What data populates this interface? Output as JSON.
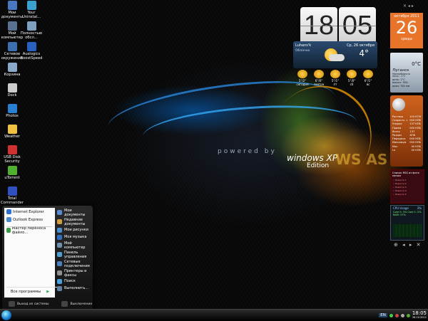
{
  "desktop_icons": [
    {
      "label": "Мои документы",
      "icon": "folder-icon",
      "color": "#4a78c0"
    },
    {
      "label": "Your Uninstal...",
      "icon": "uninstall-icon",
      "color": "#3aa0d0"
    },
    {
      "label": "Мой компьютер",
      "icon": "computer-icon",
      "color": "#5a7090"
    },
    {
      "label": "Полностью обсл...",
      "icon": "service-icon",
      "color": "#80a0c0"
    },
    {
      "label": "Сетевое окружение",
      "icon": "network-icon",
      "color": "#3b6fb0"
    },
    {
      "label": "Auslogics BoostSpeed",
      "icon": "boost-icon",
      "color": "#2a60c0"
    },
    {
      "label": "Корзина",
      "icon": "recycle-bin-icon",
      "color": "#8aa8c8"
    },
    {
      "label": "Dock",
      "icon": "dock-icon",
      "color": "#cccccc"
    },
    {
      "label": "Photos",
      "icon": "photos-icon",
      "color": "#2a80d0"
    },
    {
      "label": "Weather",
      "icon": "weather-icon",
      "color": "#f0c040"
    },
    {
      "label": "USB Disk Security",
      "icon": "usb-security-icon",
      "color": "#d03030"
    },
    {
      "label": "uTorrent",
      "icon": "utorrent-icon",
      "color": "#50b030"
    },
    {
      "label": "Total Commander",
      "icon": "total-commander-icon",
      "color": "#3050c0"
    }
  ],
  "brand": {
    "tagline": "powered by",
    "product": "windows XP",
    "edition": "Edition",
    "watermark": "WS AS"
  },
  "clock": {
    "hours": "18",
    "minutes": "05"
  },
  "weather": {
    "city": "Luhans'k",
    "condition": "Облачно",
    "date": "Ср, 26 октября",
    "temp": "4°",
    "forecast": [
      {
        "temp": "5°/2°",
        "day": "сегодня"
      },
      {
        "temp": "6°/0°",
        "day": "завтра"
      },
      {
        "temp": "5°/1°",
        "day": "пт"
      },
      {
        "temp": "5°/0°",
        "day": "сб"
      },
      {
        "temp": "6°/1°",
        "day": "вс"
      }
    ]
  },
  "calendar": {
    "month": "октября 2011",
    "day": "26",
    "weekday": "среда"
  },
  "gadget_controls": "✕ ◂ ▸",
  "weather2": {
    "temp": "0°C",
    "city": "Луганск",
    "sub": "Малооблачно",
    "rows": [
      "ночь: -1°C",
      "день: 1°C",
      "влажн: 78%",
      "давл: 762 мм"
    ]
  },
  "network": {
    "rows": [
      {
        "k": "Раствор",
        "v": "100 КГМ"
      },
      {
        "k": "Скорость ↓",
        "v": "000 КПБ"
      },
      {
        "k": "Упорка",
        "v": "137 КПБ"
      },
      {
        "k": "Прием",
        "v": "000 КПБ"
      },
      {
        "k": "Всего Раздач",
        "v": "137 КПБ"
      },
      {
        "k": "Передача",
        "v": "000 КПБ"
      },
      {
        "k": "Максимум",
        "v": "000 КПБ"
      },
      {
        "k": "Max",
        "v": "00 КПБ"
      },
      {
        "k": "Lo",
        "v": "00 КПБ"
      }
    ]
  },
  "rss": {
    "title": "Список RSS из фото мечом",
    "items": [
      "• Новости 1",
      "• Новости 2",
      "• Новости 3",
      "• Новости 4",
      "• Новости 5"
    ]
  },
  "cpu": {
    "title": "CPU Usage",
    "value": "3%",
    "cores": "Core 0: 3%  Core 1: 2%",
    "ram": "RAM: 37%"
  },
  "sidebar_controls": "⊕ ◂ ▸ ✕",
  "start_menu": {
    "pinned": [
      {
        "label": "Internet Explorer",
        "color": "#2a70d0"
      },
      {
        "label": "Outlook Express",
        "color": "#4a8ad0"
      }
    ],
    "recent": [
      {
        "label": "Мастер переноса файло...",
        "color": "#3a9a40"
      }
    ],
    "all_programs": "Все программы",
    "right_items": [
      {
        "label": "Мои документы",
        "color": "#5a8ad0"
      },
      {
        "label": "Недавние документы",
        "color": "#d0a040"
      },
      {
        "label": "Мои рисунки",
        "color": "#4a90d0"
      },
      {
        "label": "Моя музыка",
        "color": "#3070c0"
      },
      {
        "label": "Мой компьютер",
        "color": "#7090b0"
      },
      {
        "label": "Панель управления",
        "color": "#50a0d0"
      },
      {
        "label": "Сетевые подключения",
        "color": "#4a80c0"
      },
      {
        "label": "Принтеры и факсы",
        "color": "#909090"
      },
      {
        "label": "Поиск",
        "color": "#4aa0e0"
      },
      {
        "label": "Выполнить...",
        "color": "#6080a0"
      }
    ],
    "logoff": "Выход из системы",
    "shutdown": "Выключение"
  },
  "taskbar": {
    "lang": "EN",
    "time": "18:05",
    "date": "26.10.2011"
  }
}
